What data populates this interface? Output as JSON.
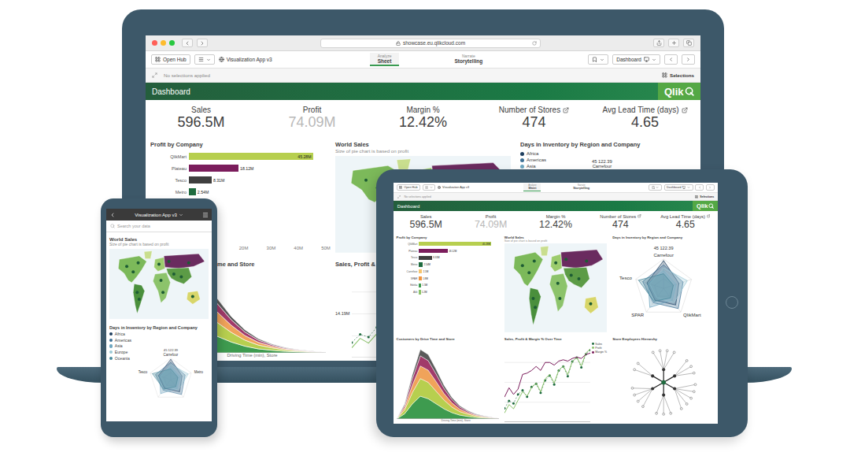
{
  "laptop": {
    "browser": {
      "url": "showcase.eu.qlikcloud.com"
    },
    "toolbar": {
      "hub": "Open Hub",
      "app": "Visualization App v3",
      "modes": [
        {
          "caption": "Analyze",
          "label": "Sheet",
          "selected": true
        },
        {
          "caption": "Narrate",
          "label": "Storytelling",
          "selected": false
        }
      ],
      "sheet": "Dashboard"
    },
    "selections": {
      "text": "No selections applied",
      "button": "Selections"
    },
    "header": {
      "title": "Dashboard",
      "logo": "Qlik"
    },
    "kpis": [
      {
        "label": "Sales",
        "value": "596.5M",
        "muted": false,
        "link": false
      },
      {
        "label": "Profit",
        "value": "74.09M",
        "muted": true,
        "link": false
      },
      {
        "label": "Margin %",
        "value": "12.42%",
        "muted": false,
        "link": false
      },
      {
        "label": "Number of Stores",
        "value": "474",
        "muted": false,
        "link": true
      },
      {
        "label": "Avg Lead Time (days)",
        "value": "4.65",
        "muted": false,
        "link": true
      }
    ],
    "panels": [
      {
        "kind": "bars",
        "title": "Profit by Company",
        "max": 50,
        "bars": [
          {
            "label": "QlikMart",
            "value": 45.28,
            "text": "45.28M",
            "color": "#b7cf4f"
          },
          {
            "label": "Plateau",
            "value": 18.12,
            "text": "18.12M",
            "color": "#7b1d5c"
          },
          {
            "label": "Tesco",
            "value": 8.31,
            "text": "8.31M",
            "color": "#3f3f3f"
          },
          {
            "label": "Metro",
            "value": 2.54,
            "text": "2.54M",
            "color": "#1f6b3f"
          }
        ],
        "ticks": [
          {
            "text": "20M",
            "value": 20
          },
          {
            "text": "30M",
            "value": 30
          },
          {
            "text": "40M",
            "value": 40
          },
          {
            "text": "50M",
            "value": 50
          }
        ]
      },
      {
        "kind": "map",
        "title": "World Sales",
        "subtitle": "Size of pie chart is based on profit"
      },
      {
        "kind": "legend",
        "title": "Days in Inventory by Region and Company",
        "legend": [
          {
            "label": "Africa",
            "color": "#1f3f5f"
          },
          {
            "label": "Americas",
            "color": "#3f7196"
          },
          {
            "label": "Asia",
            "color": "#6ea6c0"
          }
        ],
        "labels": [
          "45 122.39",
          "Carrefour"
        ]
      },
      {
        "kind": "area",
        "title": "me and Store",
        "axis": "Driving Time (min), Store",
        "series": [
          {
            "color": "#3e9b4f",
            "values": [
              0,
              20,
              60,
              90,
              80,
              60,
              40,
              25,
              15,
              10,
              6,
              4,
              2,
              1
            ]
          },
          {
            "color": "#b7cf4f",
            "values": [
              0,
              15,
              45,
              70,
              65,
              50,
              35,
              22,
              14,
              9,
              5,
              3,
              2,
              1
            ]
          },
          {
            "color": "#f0a35a",
            "values": [
              0,
              10,
              30,
              50,
              48,
              38,
              26,
              17,
              10,
              6,
              4,
              2,
              1,
              0
            ]
          },
          {
            "color": "#a13a6a",
            "values": [
              0,
              8,
              25,
              40,
              38,
              30,
              20,
              13,
              8,
              5,
              3,
              2,
              1,
              0
            ]
          },
          {
            "color": "#5a5a5a",
            "values": [
              0,
              5,
              15,
              25,
              24,
              18,
              12,
              8,
              5,
              3,
              2,
              1,
              1,
              0
            ]
          }
        ]
      },
      {
        "kind": "lines",
        "title": "Sales, Profit &",
        "labels": [
          "14.19M"
        ],
        "series": [
          {
            "kind": "dots",
            "color": "#1f6b3f",
            "values": [
              11.2,
              12.1,
              11.8,
              12.9,
              13.4,
              12.6,
              13.8,
              14.19,
              13.1,
              14.6,
              15.2,
              14.1,
              15.8,
              16.3,
              15.1,
              16.9,
              17.4,
              16.2,
              17.8,
              18.3
            ]
          },
          {
            "kind": "line",
            "color": "#8cc36b",
            "values": [
              1.4,
              1.6,
              1.5,
              1.7,
              1.9,
              1.8,
              2.0,
              2.1,
              1.9,
              2.2,
              2.3,
              2.1,
              2.4,
              2.5,
              2.3,
              2.6,
              2.7,
              2.5,
              2.8,
              2.9
            ]
          }
        ]
      }
    ]
  },
  "tablet": {
    "toolbar": {
      "hub": "Open Hub",
      "app": "Visualization App v3",
      "modes": [
        {
          "caption": "Analyze",
          "label": "Sheet",
          "selected": true
        },
        {
          "caption": "Narrate",
          "label": "Storytelling",
          "selected": false
        }
      ],
      "sheet": "Dashboard"
    },
    "selections": {
      "text": "No selections applied",
      "button": "Selections"
    },
    "header": {
      "title": "Dashboard",
      "logo": "Qlik"
    },
    "kpis": [
      {
        "label": "Sales",
        "value": "596.5M",
        "muted": false,
        "link": false
      },
      {
        "label": "Profit",
        "value": "74.09M",
        "muted": true,
        "link": false
      },
      {
        "label": "Margin %",
        "value": "12.42%",
        "muted": false,
        "link": false
      },
      {
        "label": "Number of Stores",
        "value": "474",
        "muted": false,
        "link": true
      },
      {
        "label": "Avg Lead Time (days)",
        "value": "4.65",
        "muted": false,
        "link": true
      }
    ],
    "panels": [
      {
        "kind": "bars",
        "title": "Profit by Company",
        "max": 50,
        "bars": [
          {
            "label": "QlikMart",
            "value": 45.28,
            "text": "45.28M",
            "color": "#b7cf4f"
          },
          {
            "label": "Plateau",
            "value": 18.12,
            "text": "18.12M",
            "color": "#7b1d5c"
          },
          {
            "label": "Tesco",
            "value": 8.31,
            "text": "8.31M",
            "color": "#3f3f3f"
          },
          {
            "label": "Metro",
            "value": 2.54,
            "text": "2.54M",
            "color": "#1f6b3f"
          },
          {
            "label": "Carrefour",
            "value": 2.1,
            "text": "2.1M",
            "color": "#f6c56f"
          },
          {
            "label": "SPAR",
            "value": 1.8,
            "text": "1.8M",
            "color": "#f0953f"
          },
          {
            "label": "Edeka",
            "value": 1.5,
            "text": "1.5M",
            "color": "#3e9b4f"
          },
          {
            "label": "Aldi",
            "value": 1.2,
            "text": "1.2M",
            "color": "#8cc36b"
          }
        ],
        "ticks": []
      },
      {
        "kind": "map",
        "title": "World Sales",
        "subtitle": "Size of pie chart is based on profit"
      },
      {
        "kind": "radar",
        "title": "Days in Inventory by Region and Company",
        "spokes": 5,
        "labels": [
          {
            "text": "Carrefour",
            "spoke": 0
          },
          {
            "text": "QlikMart",
            "spoke": 2
          },
          {
            "text": "SPAR",
            "spoke": 3
          },
          {
            "text": "Tesco",
            "spoke": 4
          }
        ],
        "peak": "45 122.39",
        "series": [
          {
            "color": "#1f3f5f",
            "values": [
              0.95,
              0.55,
              0.7,
              0.5,
              0.6
            ]
          },
          {
            "color": "#3f7196",
            "values": [
              0.8,
              0.7,
              0.85,
              0.6,
              0.75
            ]
          },
          {
            "color": "#6ea6c0",
            "values": [
              0.6,
              0.45,
              0.5,
              0.8,
              0.55
            ]
          },
          {
            "color": "#9cc9d6",
            "values": [
              0.7,
              0.85,
              0.6,
              0.4,
              0.5
            ]
          },
          {
            "color": "#4a8a9c",
            "values": [
              0.5,
              0.35,
              0.4,
              0.55,
              0.9
            ]
          }
        ]
      },
      {
        "kind": "area",
        "title": "Customers by Drive Time and Store",
        "axis": "Driving Time (min), Store",
        "series": [
          {
            "color": "#3e9b4f",
            "values": [
              0,
              20,
              60,
              90,
              80,
              60,
              40,
              25,
              15,
              10,
              6,
              4,
              2,
              1
            ]
          },
          {
            "color": "#b7cf4f",
            "values": [
              0,
              15,
              45,
              70,
              65,
              50,
              35,
              22,
              14,
              9,
              5,
              3,
              2,
              1
            ]
          },
          {
            "color": "#f0a35a",
            "values": [
              0,
              10,
              30,
              50,
              48,
              38,
              26,
              17,
              10,
              6,
              4,
              2,
              1,
              0
            ]
          },
          {
            "color": "#a13a6a",
            "values": [
              0,
              8,
              25,
              40,
              38,
              30,
              20,
              13,
              8,
              5,
              3,
              2,
              1,
              0
            ]
          },
          {
            "color": "#5a5a5a",
            "values": [
              0,
              5,
              15,
              25,
              24,
              18,
              12,
              8,
              5,
              3,
              2,
              1,
              1,
              0
            ]
          }
        ]
      },
      {
        "kind": "lines",
        "title": "Sales, Profit & Margin % Over Time",
        "labels": [],
        "series": [
          {
            "name": "Sales",
            "kind": "dots",
            "color": "#1f6b3f",
            "values": [
              11.2,
              12.1,
              11.8,
              12.9,
              13.4,
              12.6,
              13.8,
              14.19,
              13.1,
              14.6,
              15.2,
              14.1,
              15.8,
              16.3,
              15.1,
              16.9,
              17.4,
              16.2,
              17.8,
              18.3
            ]
          },
          {
            "name": "Profit",
            "kind": "line",
            "color": "#8cc36b",
            "values": [
              1.4,
              1.6,
              1.5,
              1.7,
              1.9,
              1.8,
              2.0,
              2.1,
              1.9,
              2.2,
              2.3,
              2.1,
              2.4,
              2.5,
              2.3,
              2.6,
              2.7,
              2.5,
              2.8,
              2.9
            ]
          },
          {
            "name": "Margin %",
            "kind": "line",
            "color": "#7b1d5c",
            "values": [
              12.5,
              13.2,
              12.7,
              13.1,
              14.2,
              14.3,
              14.5,
              14.8,
              14.5,
              15.1,
              15.1,
              14.9,
              15.2,
              15.3,
              15.2,
              15.4,
              15.5,
              15.4,
              15.7,
              15.8
            ]
          }
        ]
      },
      {
        "kind": "tree",
        "title": "Store Employees Hierarchy",
        "branches": [
          4,
          3,
          5,
          3,
          4,
          2
        ]
      }
    ]
  },
  "phone": {
    "header": {
      "title": "Visualization App v3"
    },
    "search": {
      "placeholder": "Search your data"
    },
    "map": {
      "title": "World Sales",
      "subtitle": "Size of pie chart is based on profit"
    },
    "inventory": {
      "title": "Days in Inventory by Region and Company",
      "spokes": 5,
      "labels": [
        {
          "text": "Carrefour",
          "spoke": 0
        },
        {
          "text": "Metro",
          "spoke": 1
        },
        {
          "text": "Tesco",
          "spoke": 4
        }
      ],
      "peak": "45 122.39",
      "series": [
        {
          "name": "Africa",
          "color": "#1f3f5f",
          "values": [
            0.95,
            0.55,
            0.7,
            0.5,
            0.6
          ]
        },
        {
          "name": "Americas",
          "color": "#3f7196",
          "values": [
            0.8,
            0.7,
            0.85,
            0.6,
            0.75
          ]
        },
        {
          "name": "Asia",
          "color": "#6ea6c0",
          "values": [
            0.6,
            0.45,
            0.5,
            0.8,
            0.55
          ]
        },
        {
          "name": "Europe",
          "color": "#9cc9d6",
          "values": [
            0.7,
            0.85,
            0.6,
            0.4,
            0.5
          ]
        },
        {
          "name": "Oceania",
          "color": "#4a8a9c",
          "values": [
            0.5,
            0.35,
            0.4,
            0.55,
            0.9
          ]
        }
      ]
    }
  }
}
